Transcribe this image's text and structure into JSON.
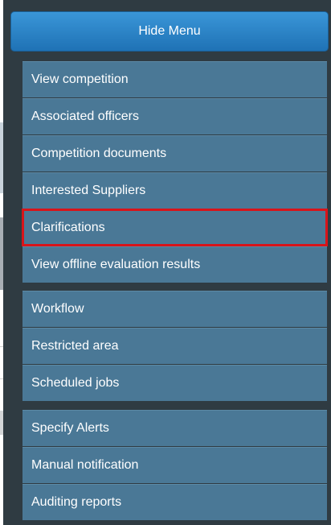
{
  "hide_menu_label": "Hide Menu",
  "colors": {
    "panel": "#2f3b42",
    "item": "#4a7896",
    "button": "#2a82c6",
    "highlight": "#d8141a"
  },
  "menu": {
    "group1": [
      {
        "label": "View competition"
      },
      {
        "label": "Associated officers"
      },
      {
        "label": "Competition documents"
      },
      {
        "label": "Interested Suppliers"
      },
      {
        "label": "Clarifications",
        "highlighted": true
      },
      {
        "label": "View offline evaluation results"
      }
    ],
    "group2": [
      {
        "label": "Workflow"
      },
      {
        "label": "Restricted area"
      },
      {
        "label": "Scheduled jobs"
      }
    ],
    "group3": [
      {
        "label": "Specify Alerts"
      },
      {
        "label": "Manual notification"
      },
      {
        "label": "Auditing reports"
      }
    ]
  }
}
